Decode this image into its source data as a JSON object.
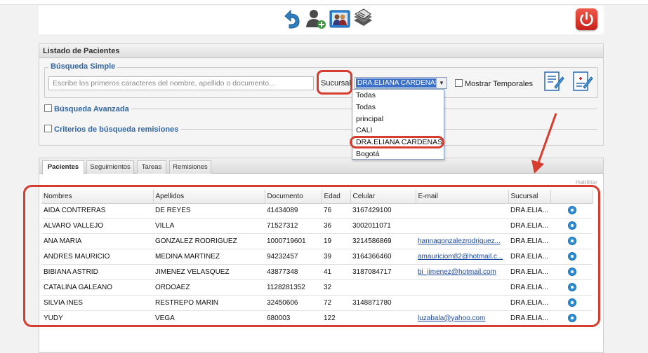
{
  "toolbar": {
    "icons": [
      "back-arrow-icon",
      "add-user-icon",
      "patients-group-icon",
      "stack-records-icon"
    ],
    "power_icon": "power-icon"
  },
  "panel": {
    "title": "Listado de Pacientes",
    "simple_search": {
      "legend": "Búsqueda Simple",
      "placeholder": "Escribe los primeros caracteres del nombre, apellido o documento...",
      "sucursal_label": "Sucursal:",
      "sucursal_value": "DRA.ELIANA CARDENAS",
      "temporales_label": "Mostrar Temporales"
    },
    "advanced_label": "Búsqueda Avanzada",
    "remisiones_label": "Criterios de búsqueda remisiones"
  },
  "dropdown": {
    "options": [
      "Todas",
      "Todas",
      "principal",
      "CALI",
      "DRA.ELIANA CARDENAS",
      "Bogotá"
    ]
  },
  "tabs": [
    "Pacientes",
    "Seguimientos",
    "Tareas",
    "Remisiones"
  ],
  "habilitar": "Habilitar",
  "table": {
    "columns": [
      "Nombres",
      "Apellidos",
      "Documento",
      "Edad",
      "Celular",
      "E-mail",
      "Sucursal"
    ],
    "rows": [
      {
        "nombres": "AIDA CONTRERAS",
        "apellidos": "DE REYES",
        "documento": "41434089",
        "edad": "76",
        "celular": "3167429100",
        "email": "",
        "sucursal": "DRA.ELIA..."
      },
      {
        "nombres": "ALVARO VALLEJO",
        "apellidos": "VILLA",
        "documento": "71527312",
        "edad": "36",
        "celular": "3002011071",
        "email": "",
        "sucursal": "DRA.ELIA..."
      },
      {
        "nombres": "ANA MARIA",
        "apellidos": "GONZALEZ RODRIGUEZ",
        "documento": "1000719601",
        "edad": "19",
        "celular": "3214586869",
        "email": "hannagonzalezrodriguez...",
        "sucursal": "DRA.ELIA..."
      },
      {
        "nombres": "ANDRES MAURICIO",
        "apellidos": "MEDINA MARTINEZ",
        "documento": "94232457",
        "edad": "39",
        "celular": "3164366460",
        "email": "amauriciom82@hotmail.c...",
        "sucursal": "DRA.ELIA..."
      },
      {
        "nombres": "BIBIANA ASTRID",
        "apellidos": "JIMENEZ VELASQUEZ",
        "documento": "43877348",
        "edad": "41",
        "celular": "3187084717",
        "email": "bi_jimenez@hotmail.com",
        "sucursal": "DRA.ELIA..."
      },
      {
        "nombres": "CATALINA GALEANO",
        "apellidos": "ORDOAEZ",
        "documento": "1128281352",
        "edad": "32",
        "celular": "",
        "email": "",
        "sucursal": "DRA.ELIA..."
      },
      {
        "nombres": "SILVIA INES",
        "apellidos": "RESTREPO MARIN",
        "documento": "32450606",
        "edad": "72",
        "celular": "3148871780",
        "email": "",
        "sucursal": "DRA.ELIA..."
      },
      {
        "nombres": "YUDY",
        "apellidos": "VEGA",
        "documento": "680003",
        "edad": "122",
        "celular": "",
        "email": "luzabala@yahoo.com",
        "sucursal": "DRA.ELIA..."
      }
    ]
  },
  "colors": {
    "highlight": "#d63d2e",
    "legend_blue": "#3366a0",
    "selection_blue": "#3a70c8",
    "link_blue": "#1a4aa0"
  }
}
